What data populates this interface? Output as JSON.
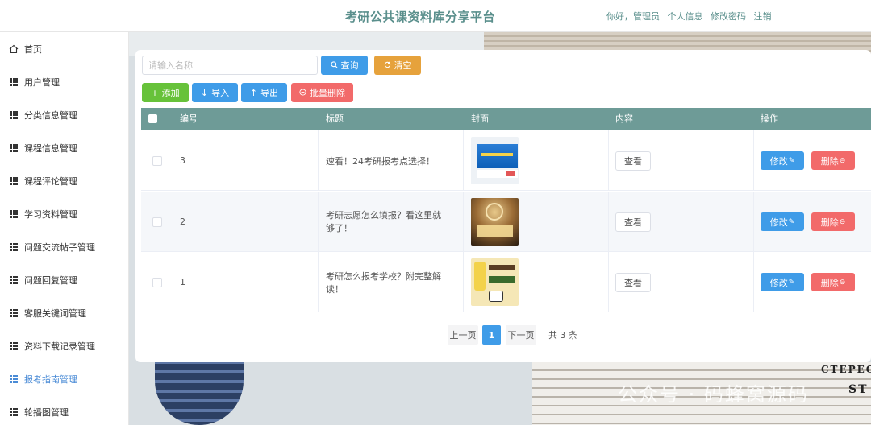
{
  "header": {
    "title": "考研公共课资料库分享平台",
    "greeting": "你好，管理员",
    "links": [
      "个人信息",
      "修改密码",
      "注销"
    ]
  },
  "sidebar": {
    "items": [
      {
        "label": "首页",
        "icon": "home-icon"
      },
      {
        "label": "用户管理",
        "icon": "grid-icon"
      },
      {
        "label": "分类信息管理",
        "icon": "grid-icon"
      },
      {
        "label": "课程信息管理",
        "icon": "grid-icon"
      },
      {
        "label": "课程评论管理",
        "icon": "grid-icon"
      },
      {
        "label": "学习资料管理",
        "icon": "grid-icon"
      },
      {
        "label": "问题交流帖子管理",
        "icon": "grid-icon"
      },
      {
        "label": "问题回复管理",
        "icon": "grid-icon"
      },
      {
        "label": "客服关键词管理",
        "icon": "grid-icon"
      },
      {
        "label": "资料下载记录管理",
        "icon": "grid-icon"
      },
      {
        "label": "报考指南管理",
        "icon": "grid-icon",
        "active": true
      },
      {
        "label": "轮播图管理",
        "icon": "grid-icon"
      }
    ]
  },
  "search": {
    "placeholder": "请输入名称",
    "query_label": "查询",
    "clear_label": "清空"
  },
  "toolbar": {
    "add_label": "添加",
    "import_label": "导入",
    "export_label": "导出",
    "batch_delete_label": "批量删除"
  },
  "table": {
    "headers": [
      "编号",
      "标题",
      "封面",
      "内容",
      "操作"
    ],
    "rows": [
      {
        "id": "3",
        "title": "速看！24考研报考点选择！",
        "cover": "screenshot-cover",
        "content_label": "查看",
        "edit_label": "修改",
        "delete_label": "删除"
      },
      {
        "id": "2",
        "title": "考研志愿怎么填报？看这里就够了！",
        "cover": "kaoyan-cover",
        "content_label": "查看",
        "edit_label": "修改",
        "delete_label": "删除"
      },
      {
        "id": "1",
        "title": "考研怎么报考学校？附完整解读！",
        "cover": "cartoon-cover",
        "content_label": "查看",
        "edit_label": "修改",
        "delete_label": "删除"
      }
    ]
  },
  "pagination": {
    "prev_label": "上一页",
    "current_page": "1",
    "next_label": "下一页",
    "total_label": "共 3 条"
  },
  "background": {
    "stack_text_1": "CTEPEO",
    "stack_text_2": "ST",
    "watermark": "公众号 · 码蜂窝源码"
  },
  "colors": {
    "header_title": "#5a8f8c",
    "table_header": "#6e9b97",
    "primary": "#3f9ce8",
    "warning": "#e6a23c",
    "success": "#67c23a",
    "danger": "#f26a6a",
    "active_menu": "#4a8bd6"
  }
}
